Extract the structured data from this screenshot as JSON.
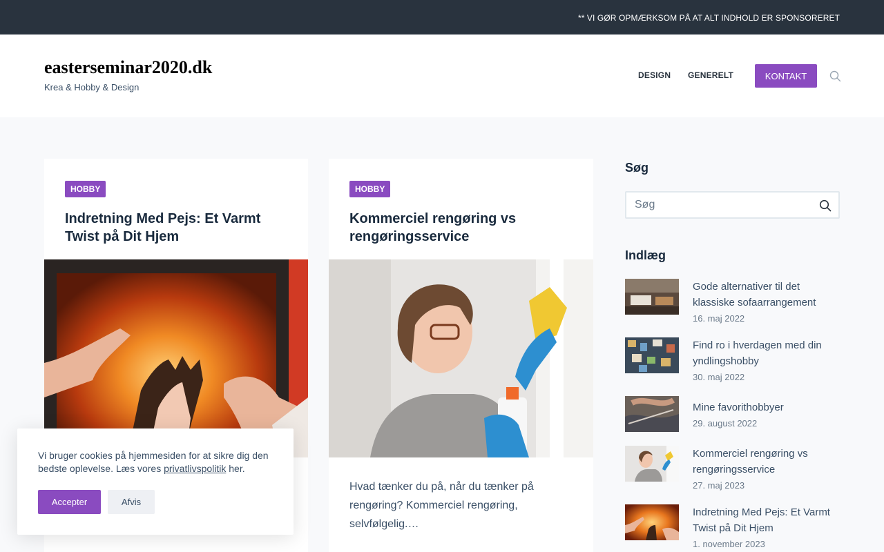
{
  "topbar": {
    "notice": "** VI GØR OPMÆRKSOM PÅ AT ALT INDHOLD ER SPONSORERET"
  },
  "header": {
    "site_title": "easterseminar2020.dk",
    "tagline": "Krea & Hobby & Design",
    "nav": [
      "DESIGN",
      "GENERELT"
    ],
    "cta": "KONTAKT",
    "search_icon": "search-icon"
  },
  "cards": [
    {
      "category": "HOBBY",
      "title": "Indretning Med Pejs: Et Varmt Twist på Dit Hjem",
      "image": "fireplace-hands-image",
      "excerpt": ""
    },
    {
      "category": "HOBBY",
      "title": "Kommerciel rengøring vs rengøringsservice",
      "image": "woman-cleaning-window-image",
      "excerpt": "Hvad tænker du på, når du tænker på rengøring? Kommerciel rengøring, selvfølgelig.…"
    }
  ],
  "sidebar": {
    "search_title": "Søg",
    "search_placeholder": "Søg",
    "posts_title": "Indlæg",
    "posts": [
      {
        "title": "Gode alternativer til det klassiske sofaarrangement",
        "date": "16. maj 2022"
      },
      {
        "title": "Find ro i hverdagen med din yndlingshobby",
        "date": "30. maj 2022"
      },
      {
        "title": "Mine favorithobbyer",
        "date": "29. august 2022"
      },
      {
        "title": "Kommerciel rengøring vs rengøringsservice",
        "date": "27. maj 2023"
      },
      {
        "title": "Indretning Med Pejs: Et Varmt Twist på Dit Hjem",
        "date": "1. november 2023"
      }
    ]
  },
  "cookie": {
    "text_before": "Vi bruger cookies på hjemmesiden for at sikre dig den bedste oplevelse. Læs vores ",
    "link": "privatlivspolitik",
    "text_after": " her.",
    "accept": "Accepter",
    "decline": "Afvis"
  },
  "colors": {
    "accent": "#8a4bc0",
    "topbar": "#29333e",
    "heading": "#192a3d",
    "text": "#3a4f66"
  }
}
